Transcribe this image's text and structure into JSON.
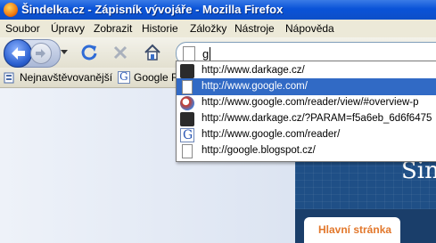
{
  "window": {
    "title": "Šindelka.cz - Zápisník vývojáře - Mozilla Firefox"
  },
  "menu": [
    {
      "label": "Soubor"
    },
    {
      "label": "Úpravy"
    },
    {
      "label": "Zobrazit"
    },
    {
      "label": "Historie"
    },
    {
      "label": "Záložky"
    },
    {
      "label": "Nástroje"
    },
    {
      "label": "Nápověda"
    }
  ],
  "toolbar": {
    "buttons": [
      {
        "name": "back-button",
        "icon": "back-arrow-icon"
      },
      {
        "name": "forward-button",
        "icon": "forward-arrow-icon"
      },
      {
        "name": "reload-button",
        "icon": "reload-icon"
      },
      {
        "name": "stop-button",
        "icon": "stop-icon"
      },
      {
        "name": "home-button",
        "icon": "home-icon"
      }
    ]
  },
  "address_bar": {
    "value": "g"
  },
  "bookmarks": [
    {
      "label": "Nejnavštěvovanější",
      "icon": "most-visited-icon"
    },
    {
      "label": "Google R",
      "icon": "google-icon"
    }
  ],
  "autocomplete": [
    {
      "url": "http://www.darkage.cz/",
      "icon": "darkage-icon",
      "selected": false
    },
    {
      "url": "http://www.google.com/",
      "icon": "page-icon",
      "selected": true
    },
    {
      "url": "http://www.google.com/reader/view/#overview-p",
      "icon": "reader-icon",
      "selected": false
    },
    {
      "url": "http://www.darkage.cz/?PARAM=f5a6eb_6d6f6475",
      "icon": "darkage-icon",
      "selected": false
    },
    {
      "url": "http://www.google.com/reader/",
      "icon": "google-icon",
      "selected": false
    },
    {
      "url": "http://google.blogspot.cz/",
      "icon": "page-icon",
      "selected": false
    }
  ],
  "site": {
    "name": "Šin",
    "nav_tab": "Hlavní stránka"
  },
  "colors": {
    "titlebar": "#0a53d8",
    "selection": "#316ac5",
    "site_header": "#1f4f86",
    "site_tab_text": "#e2772b"
  }
}
